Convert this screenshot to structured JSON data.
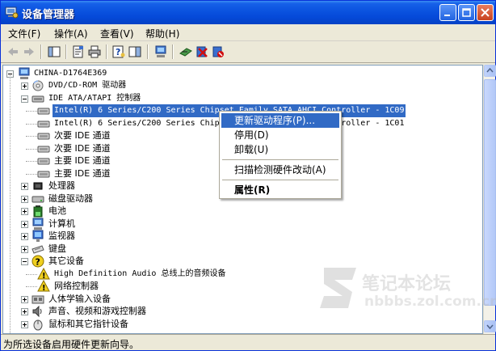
{
  "window": {
    "title": "设备管理器",
    "buttons": [
      "minimize",
      "maximize",
      "close"
    ]
  },
  "menu": [
    "文件(F)",
    "操作(A)",
    "查看(V)",
    "帮助(H)"
  ],
  "toolbar": {
    "icons": [
      "back-icon",
      "forward-icon",
      "show-hide-console-tree-icon",
      "properties-icon",
      "print-icon",
      "help-icon",
      "show-hide-action-pane-icon",
      "computer-icon",
      "scan-hardware-icon",
      "uninstall-icon",
      "disable-icon"
    ]
  },
  "tree": {
    "root": "CHINA-D1764E369",
    "items": [
      {
        "label": "DVD/CD-ROM 驱动器",
        "level": 1,
        "expander": "plus",
        "icon": "dvd-drive-icon"
      },
      {
        "label": "IDE ATA/ATAPI 控制器",
        "level": 1,
        "expander": "minus",
        "icon": "ide-controller-icon"
      },
      {
        "label": "Intel(R) 6 Series/C200 Series Chipset Family SATA AHCI Controller - 1C09",
        "level": 2,
        "icon": "ide-channel-icon",
        "selected": true
      },
      {
        "label": "Intel(R) 6 Series/C200 Series Chipset Family SATA AHCI Controller - 1C01",
        "level": 2,
        "icon": "ide-channel-icon"
      },
      {
        "label": "次要 IDE 通道",
        "level": 2,
        "icon": "ide-channel-icon"
      },
      {
        "label": "次要 IDE 通道",
        "level": 2,
        "icon": "ide-channel-icon"
      },
      {
        "label": "主要 IDE 通道",
        "level": 2,
        "icon": "ide-channel-icon"
      },
      {
        "label": "主要 IDE 通道",
        "level": 2,
        "icon": "ide-channel-icon"
      },
      {
        "label": "处理器",
        "level": 1,
        "expander": "plus",
        "icon": "processor-icon"
      },
      {
        "label": "磁盘驱动器",
        "level": 1,
        "expander": "plus",
        "icon": "disk-drive-icon"
      },
      {
        "label": "电池",
        "level": 1,
        "expander": "plus",
        "icon": "battery-icon"
      },
      {
        "label": "计算机",
        "level": 1,
        "expander": "plus",
        "icon": "computer-icon"
      },
      {
        "label": "监视器",
        "level": 1,
        "expander": "plus",
        "icon": "monitor-icon"
      },
      {
        "label": "键盘",
        "level": 1,
        "expander": "plus",
        "icon": "keyboard-icon"
      },
      {
        "label": "其它设备",
        "level": 1,
        "expander": "minus",
        "icon": "unknown-device-icon"
      },
      {
        "label": "High Definition Audio 总线上的音频设备",
        "level": 2,
        "icon": "warning-device-icon"
      },
      {
        "label": "网络控制器",
        "level": 2,
        "icon": "warning-device-icon"
      },
      {
        "label": "人体学输入设备",
        "level": 1,
        "expander": "plus",
        "icon": "hid-icon"
      },
      {
        "label": "声音、视频和游戏控制器",
        "level": 1,
        "expander": "plus",
        "icon": "sound-icon"
      },
      {
        "label": "鼠标和其它指针设备",
        "level": 1,
        "expander": "plus",
        "icon": "mouse-icon"
      }
    ]
  },
  "context_menu": {
    "items": [
      {
        "label": "更新驱动程序(P)...",
        "highlighted": true
      },
      {
        "label": "停用(D)"
      },
      {
        "label": "卸载(U)"
      },
      {
        "separator": true
      },
      {
        "label": "扫描检测硬件改动(A)"
      },
      {
        "separator": true
      },
      {
        "label": "属性(R)",
        "bold": true
      }
    ]
  },
  "statusbar": {
    "text": "为所选设备启用硬件更新向导。"
  },
  "watermark": {
    "line1": "笔记本论坛",
    "line2": "nbbbs.zol.com.cn"
  },
  "colors": {
    "titlebar": "#0a52df",
    "selection": "#316ac5",
    "window_bg": "#ece9d8"
  }
}
